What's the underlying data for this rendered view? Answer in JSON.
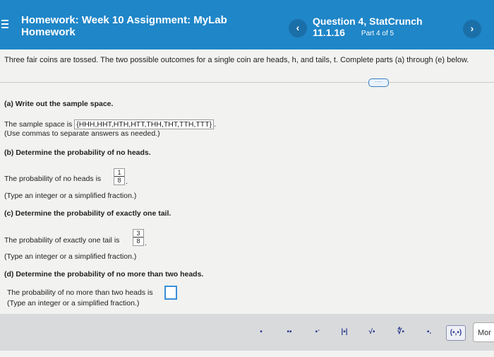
{
  "header": {
    "homework_title": "Homework: Week 10 Assignment: MyLab Homework",
    "question_title": "Question 4, StatCrunch 11.1.16",
    "part": "Part 4 of 5",
    "prev_symbol": "‹",
    "next_symbol": "›"
  },
  "intro": "Three fair coins are tossed. The two possible outcomes for a single coin are heads, h, and tails, t. Complete parts (a) through (e) below.",
  "more_pill": "····",
  "part_a": {
    "label": "(a) Write out the sample space.",
    "answer_prefix": "The sample space is",
    "sample_space": "{HHH,HHT,HTH,HTT,THH,THT,TTH,TTT}",
    "answer_suffix": ".",
    "hint": "(Use commas to separate answers as needed.)"
  },
  "part_b": {
    "label": "(b) Determine the probability of no heads.",
    "answer_prefix": "The probability of no heads is",
    "numerator": "1",
    "denominator": "8",
    "answer_suffix": ".",
    "hint": "(Type an integer or a simplified fraction.)"
  },
  "part_c": {
    "label": "(c) Determine the probability of exactly one tail.",
    "answer_prefix": "The probability of exactly one tail is",
    "numerator": "3",
    "denominator": "8",
    "answer_suffix": ".",
    "hint": "(Type an integer or a simplified fraction.)"
  },
  "part_d": {
    "label": "(d) Determine the probability of no more than two heads.",
    "answer_prefix": "The probability of no more than two heads is",
    "hint": "(Type an integer or a simplified fraction.)"
  },
  "toolbar": {
    "tools": [
      {
        "name": "fraction-tool",
        "symbol": "▪",
        "icon": "fraction-icon"
      },
      {
        "name": "mixed-number-tool",
        "symbol": "▪▪",
        "icon": "mixed-number-icon"
      },
      {
        "name": "exponent-tool",
        "symbol": "▪ˑ",
        "icon": "exponent-icon"
      },
      {
        "name": "absolute-value-tool",
        "symbol": "|▪|",
        "icon": "absolute-value-icon"
      },
      {
        "name": "square-root-tool",
        "symbol": "√▪",
        "icon": "square-root-icon"
      },
      {
        "name": "nth-root-tool",
        "symbol": "∜▪",
        "icon": "nth-root-icon"
      },
      {
        "name": "decimal-tool",
        "symbol": "▪.",
        "icon": "decimal-icon"
      },
      {
        "name": "interval-tool",
        "symbol": "(▪,▪)",
        "icon": "interval-icon"
      }
    ],
    "more_label": "Mor"
  },
  "colors": {
    "header_bg": "#1f86c8",
    "nav_button_bg": "#1b6fa8",
    "answer_box_border": "#3a8fd8",
    "toolbar_bg": "#d8dadc"
  }
}
